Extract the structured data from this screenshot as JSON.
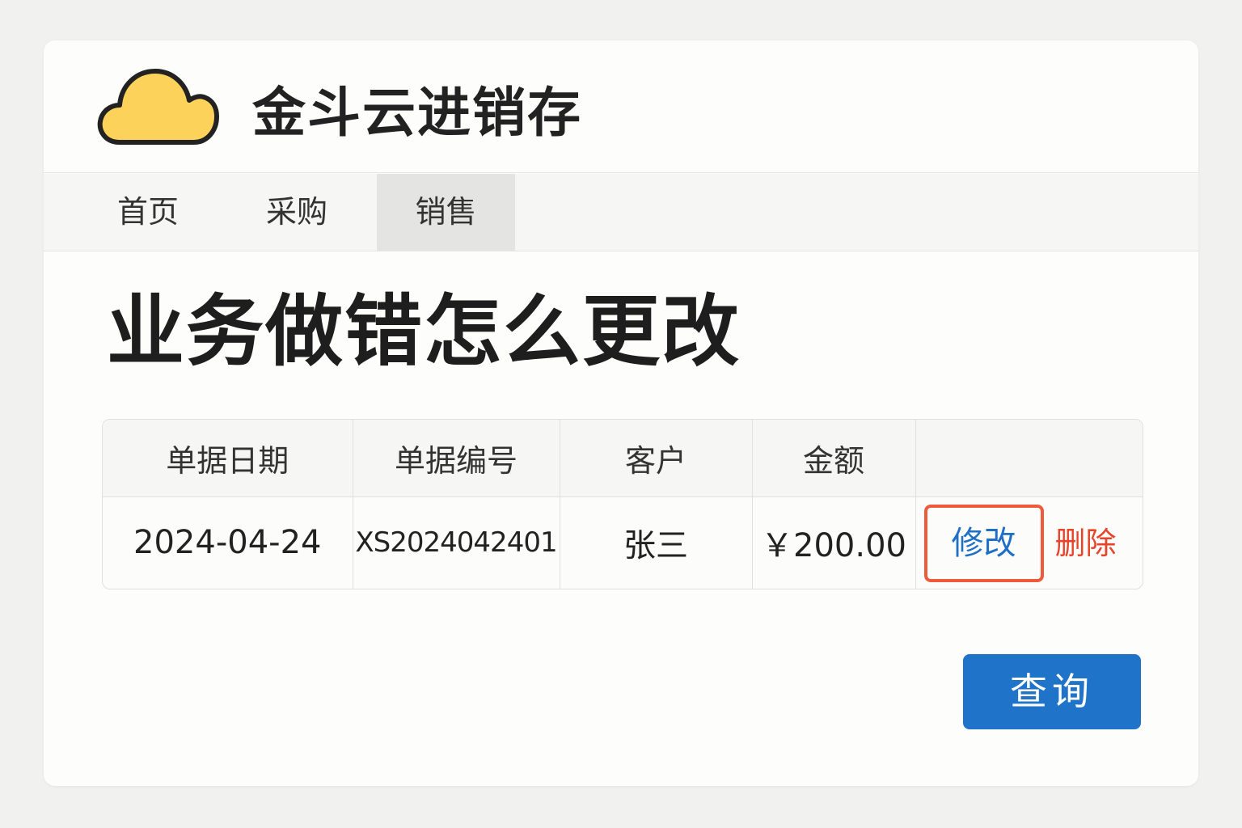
{
  "app": {
    "title": "金斗云进销存",
    "logo_icon": "cloud-icon",
    "logo_color": "#fdd25a"
  },
  "nav": {
    "items": [
      {
        "label": "首页",
        "active": false
      },
      {
        "label": "采购",
        "active": false
      },
      {
        "label": "销售",
        "active": true
      }
    ]
  },
  "page": {
    "heading": "业务做错怎么更改"
  },
  "table": {
    "headers": [
      "单据日期",
      "单据编号",
      "客户",
      "金额",
      ""
    ],
    "rows": [
      {
        "date": "2024-04-24",
        "number": "XS2024042401",
        "customer": "张三",
        "amount": "￥200.00",
        "edit_label": "修改",
        "delete_label": "删除"
      }
    ]
  },
  "actions": {
    "query_label": "查询"
  },
  "colors": {
    "primary": "#1f73c8",
    "highlight_border": "#ef5b3a",
    "danger": "#e8442a",
    "link": "#1f6fc5"
  }
}
